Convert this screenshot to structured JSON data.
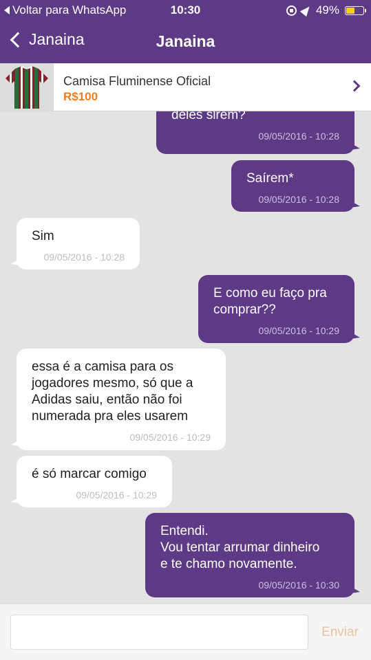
{
  "status_bar": {
    "back_label": "Voltar para WhatsApp",
    "time": "10:30",
    "battery_text": "49%",
    "battery_level": 0.49,
    "icons": [
      "rotation-lock-icon",
      "location-arrow-icon",
      "battery-icon"
    ]
  },
  "navbar": {
    "back_label": "Janaina",
    "title": "Janaina"
  },
  "product": {
    "name": "Camisa Fluminense Oficial",
    "price": "R$100"
  },
  "messages": [
    {
      "side": "sent",
      "text": "deles slrem?",
      "time": "09/05/2016 - 10:28"
    },
    {
      "side": "sent",
      "text": "Saírem*",
      "time": "09/05/2016 - 10:28"
    },
    {
      "side": "recv",
      "text": "Sim",
      "time": "09/05/2016 - 10:28"
    },
    {
      "side": "sent",
      "text": "E como eu faço pra\ncomprar??",
      "time": "09/05/2016 - 10:29"
    },
    {
      "side": "recv",
      "text": "essa é a camisa para os\njogadores mesmo, só que a\nAdidas saiu, então não foi\nnumerada pra eles usarem",
      "time": "09/05/2016 - 10:29"
    },
    {
      "side": "recv",
      "text": "é só marcar comigo",
      "time": "09/05/2016 - 10:29"
    },
    {
      "side": "sent",
      "text": "Entendi.\nVou tentar arrumar dinheiro\ne te chamo novamente.",
      "time": "09/05/2016 - 10:30"
    }
  ],
  "composer": {
    "placeholder": "",
    "send_label": "Enviar"
  },
  "colors": {
    "header": "#5e3a86",
    "sent_bubble": "#5e3a86",
    "received_bubble": "#ffffff",
    "chat_background": "#e3e3e3",
    "price": "#f07d1a",
    "send_disabled": "#e8c39d"
  }
}
